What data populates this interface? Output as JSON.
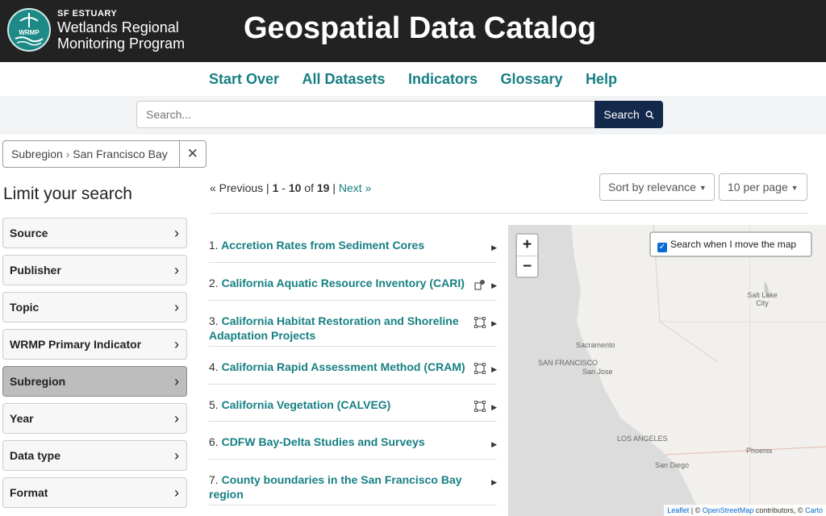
{
  "header": {
    "logo_abbrev": "WRMP",
    "logo_small": "SF ESTUARY",
    "logo_line1": "Wetlands Regional",
    "logo_line2": "Monitoring Program",
    "title": "Geospatial Data Catalog"
  },
  "nav": [
    "Start Over",
    "All Datasets",
    "Indicators",
    "Glossary",
    "Help"
  ],
  "search": {
    "placeholder": "Search...",
    "button_label": "Search"
  },
  "constraint": {
    "field": "Subregion",
    "value": "San Francisco Bay"
  },
  "sidebar": {
    "title": "Limit your search",
    "facets": [
      "Source",
      "Publisher",
      "Topic",
      "WRMP Primary Indicator",
      "Subregion",
      "Year",
      "Data type",
      "Format"
    ]
  },
  "pager": {
    "previous": "« Previous",
    "start": "1",
    "end": "10",
    "total": "19",
    "next": "Next »"
  },
  "sort": {
    "label": "Sort by relevance"
  },
  "per_page": {
    "label": "10 per page"
  },
  "results": [
    {
      "num": "1.",
      "title": "Accretion Rates from Sediment Cores",
      "icon": ""
    },
    {
      "num": "2.",
      "title": "California Aquatic Resource Inventory (CARI)",
      "icon": "point-polygon-icon"
    },
    {
      "num": "3.",
      "title": "California Habitat Restoration and Shoreline Adaptation Projects",
      "icon": "polygon-icon"
    },
    {
      "num": "4.",
      "title": "California Rapid Assessment Method (CRAM)",
      "icon": "polygon-icon"
    },
    {
      "num": "5.",
      "title": "California Vegetation (CALVEG)",
      "icon": "polygon-icon"
    },
    {
      "num": "6.",
      "title": "CDFW Bay-Delta Studies and Surveys",
      "icon": ""
    },
    {
      "num": "7.",
      "title": "County boundaries in the San Francisco Bay region",
      "icon": ""
    }
  ],
  "map": {
    "zoom_in": "+",
    "zoom_out": "−",
    "checkbox_label": "Search when I move the map",
    "labels": [
      "Salt Lake City",
      "Sacramento",
      "SAN FRANCISCO",
      "San Jose",
      "LOS ANGELES",
      "San Diego",
      "Phoenix"
    ],
    "attribution": {
      "leaflet": "Leaflet",
      "osm": "OpenStreetMap",
      "contrib": "contributors, ©",
      "carto": "Carto"
    }
  },
  "colors": {
    "accent": "#167f83",
    "header_bg": "#222222",
    "search_button": "#13294b"
  }
}
